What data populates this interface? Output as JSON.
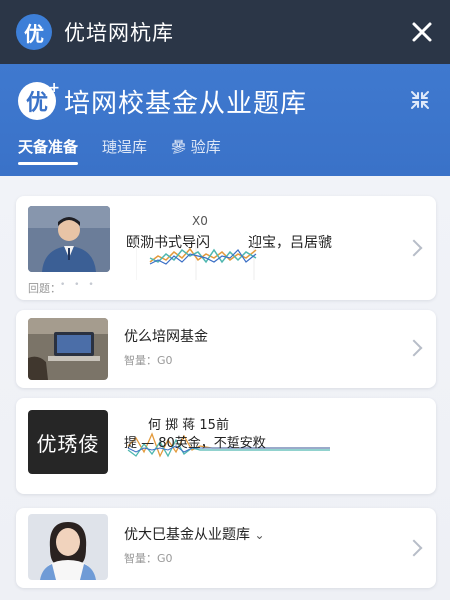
{
  "app": {
    "logo_char": "优",
    "title": "优培网杭库"
  },
  "hero": {
    "logo_char": "优",
    "logo_plus": "+",
    "title": "培网校基金从业题库"
  },
  "tabs": [
    {
      "label": "天备准备",
      "active": true
    },
    {
      "label": "璉逞库",
      "active": false
    },
    {
      "label": "曑 验库",
      "active": false
    }
  ],
  "cards": [
    {
      "title": "颐泐书式导闪",
      "title_right": "迎宝，吕居虢",
      "chart_label": "X0",
      "meta": "回题：",
      "dots": "• • •"
    },
    {
      "title": "优么培网基金",
      "meta": "智量：G0"
    },
    {
      "thumb_text": "优琇倰",
      "title_top": "何 掷 蒋 15前",
      "title": "提 — 80英金，不踅安敉"
    },
    {
      "title": "优大巳基金从业题库",
      "title_suffix": "⌄",
      "meta": "智量：G0"
    }
  ],
  "colors": {
    "topbar": "#2b3647",
    "hero": "#3a72c8",
    "accent_orange": "#e39a3c",
    "accent_teal": "#4fb7b0",
    "accent_blue": "#3b6fc5"
  }
}
